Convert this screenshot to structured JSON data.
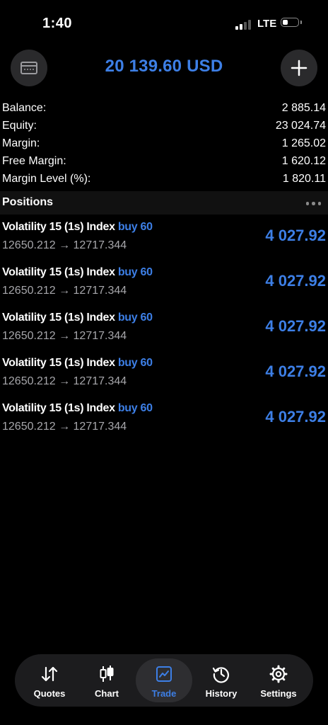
{
  "status": {
    "time": "1:40",
    "network": "LTE"
  },
  "header": {
    "total": "20 139.60 USD",
    "left_icon": "wallet-icon",
    "right_icon": "plus-icon"
  },
  "summary": [
    {
      "label": "Balance:",
      "value": "2 885.14"
    },
    {
      "label": "Equity:",
      "value": "23 024.74"
    },
    {
      "label": "Margin:",
      "value": "1 265.02"
    },
    {
      "label": "Free Margin:",
      "value": "1 620.12"
    },
    {
      "label": "Margin Level (%):",
      "value": "1 820.11"
    }
  ],
  "positions": {
    "title": "Positions",
    "items": [
      {
        "symbol": "Volatility 15 (1s) Index",
        "side": "buy 60",
        "prices": "12650.212 → 12717.344",
        "profit": "4 027.92"
      },
      {
        "symbol": "Volatility 15 (1s) Index",
        "side": "buy 60",
        "prices": "12650.212 → 12717.344",
        "profit": "4 027.92"
      },
      {
        "symbol": "Volatility 15 (1s) Index",
        "side": "buy 60",
        "prices": "12650.212 → 12717.344",
        "profit": "4 027.92"
      },
      {
        "symbol": "Volatility 15 (1s) Index",
        "side": "buy 60",
        "prices": "12650.212 → 12717.344",
        "profit": "4 027.92"
      },
      {
        "symbol": "Volatility 15 (1s) Index",
        "side": "buy 60",
        "prices": "12650.212 → 12717.344",
        "profit": "4 027.92"
      }
    ]
  },
  "tabs": [
    {
      "label": "Quotes",
      "icon": "arrows-updown-icon"
    },
    {
      "label": "Chart",
      "icon": "candlestick-icon"
    },
    {
      "label": "Trade",
      "icon": "trade-chart-icon",
      "active": true
    },
    {
      "label": "History",
      "icon": "history-icon"
    },
    {
      "label": "Settings",
      "icon": "gear-icon"
    }
  ],
  "colors": {
    "accent": "#3d7fe6",
    "background": "#000000",
    "secondary_text": "#a7a7ab"
  }
}
